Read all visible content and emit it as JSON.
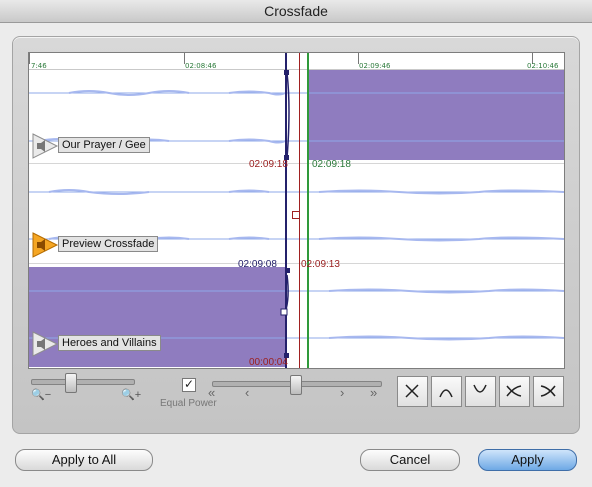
{
  "window": {
    "title": "Crossfade"
  },
  "ruler": {
    "labels": [
      "7:46",
      "02:08:46",
      "02:09:46",
      "02:10:46"
    ]
  },
  "tracks": [
    {
      "label": "Our Prayer / Gee"
    },
    {
      "label": "Preview Crossfade"
    },
    {
      "label": "Heroes and Villains"
    }
  ],
  "markers": {
    "t1": "02:09:18",
    "t2": "02:09:18",
    "t3": "02:09:08",
    "t4": "02:09:13",
    "t5": "00:00:04"
  },
  "colors": {
    "fade_region": "#8f7cbf",
    "green_line": "#2f9a3a",
    "red_line": "#a02020",
    "navy_line": "#24216b",
    "marker_red": "#9b2020",
    "marker_green": "#2b7a3a",
    "marker_navy": "#24216b"
  },
  "controls": {
    "equal_power_label": "Equal Power",
    "equal_power_checked": true,
    "zoom_out_icon": "zoom-out-icon",
    "zoom_in_icon": "zoom-in-icon",
    "nav": {
      "first": "«",
      "prev": "‹",
      "next": "›",
      "last": "»"
    },
    "shapes": [
      "x-shape",
      "cap-shape",
      "cup-shape",
      "curved-x-shape",
      "reverse-curved-x-shape"
    ]
  },
  "buttons": {
    "apply_all": "Apply to All",
    "cancel": "Cancel",
    "apply": "Apply"
  }
}
